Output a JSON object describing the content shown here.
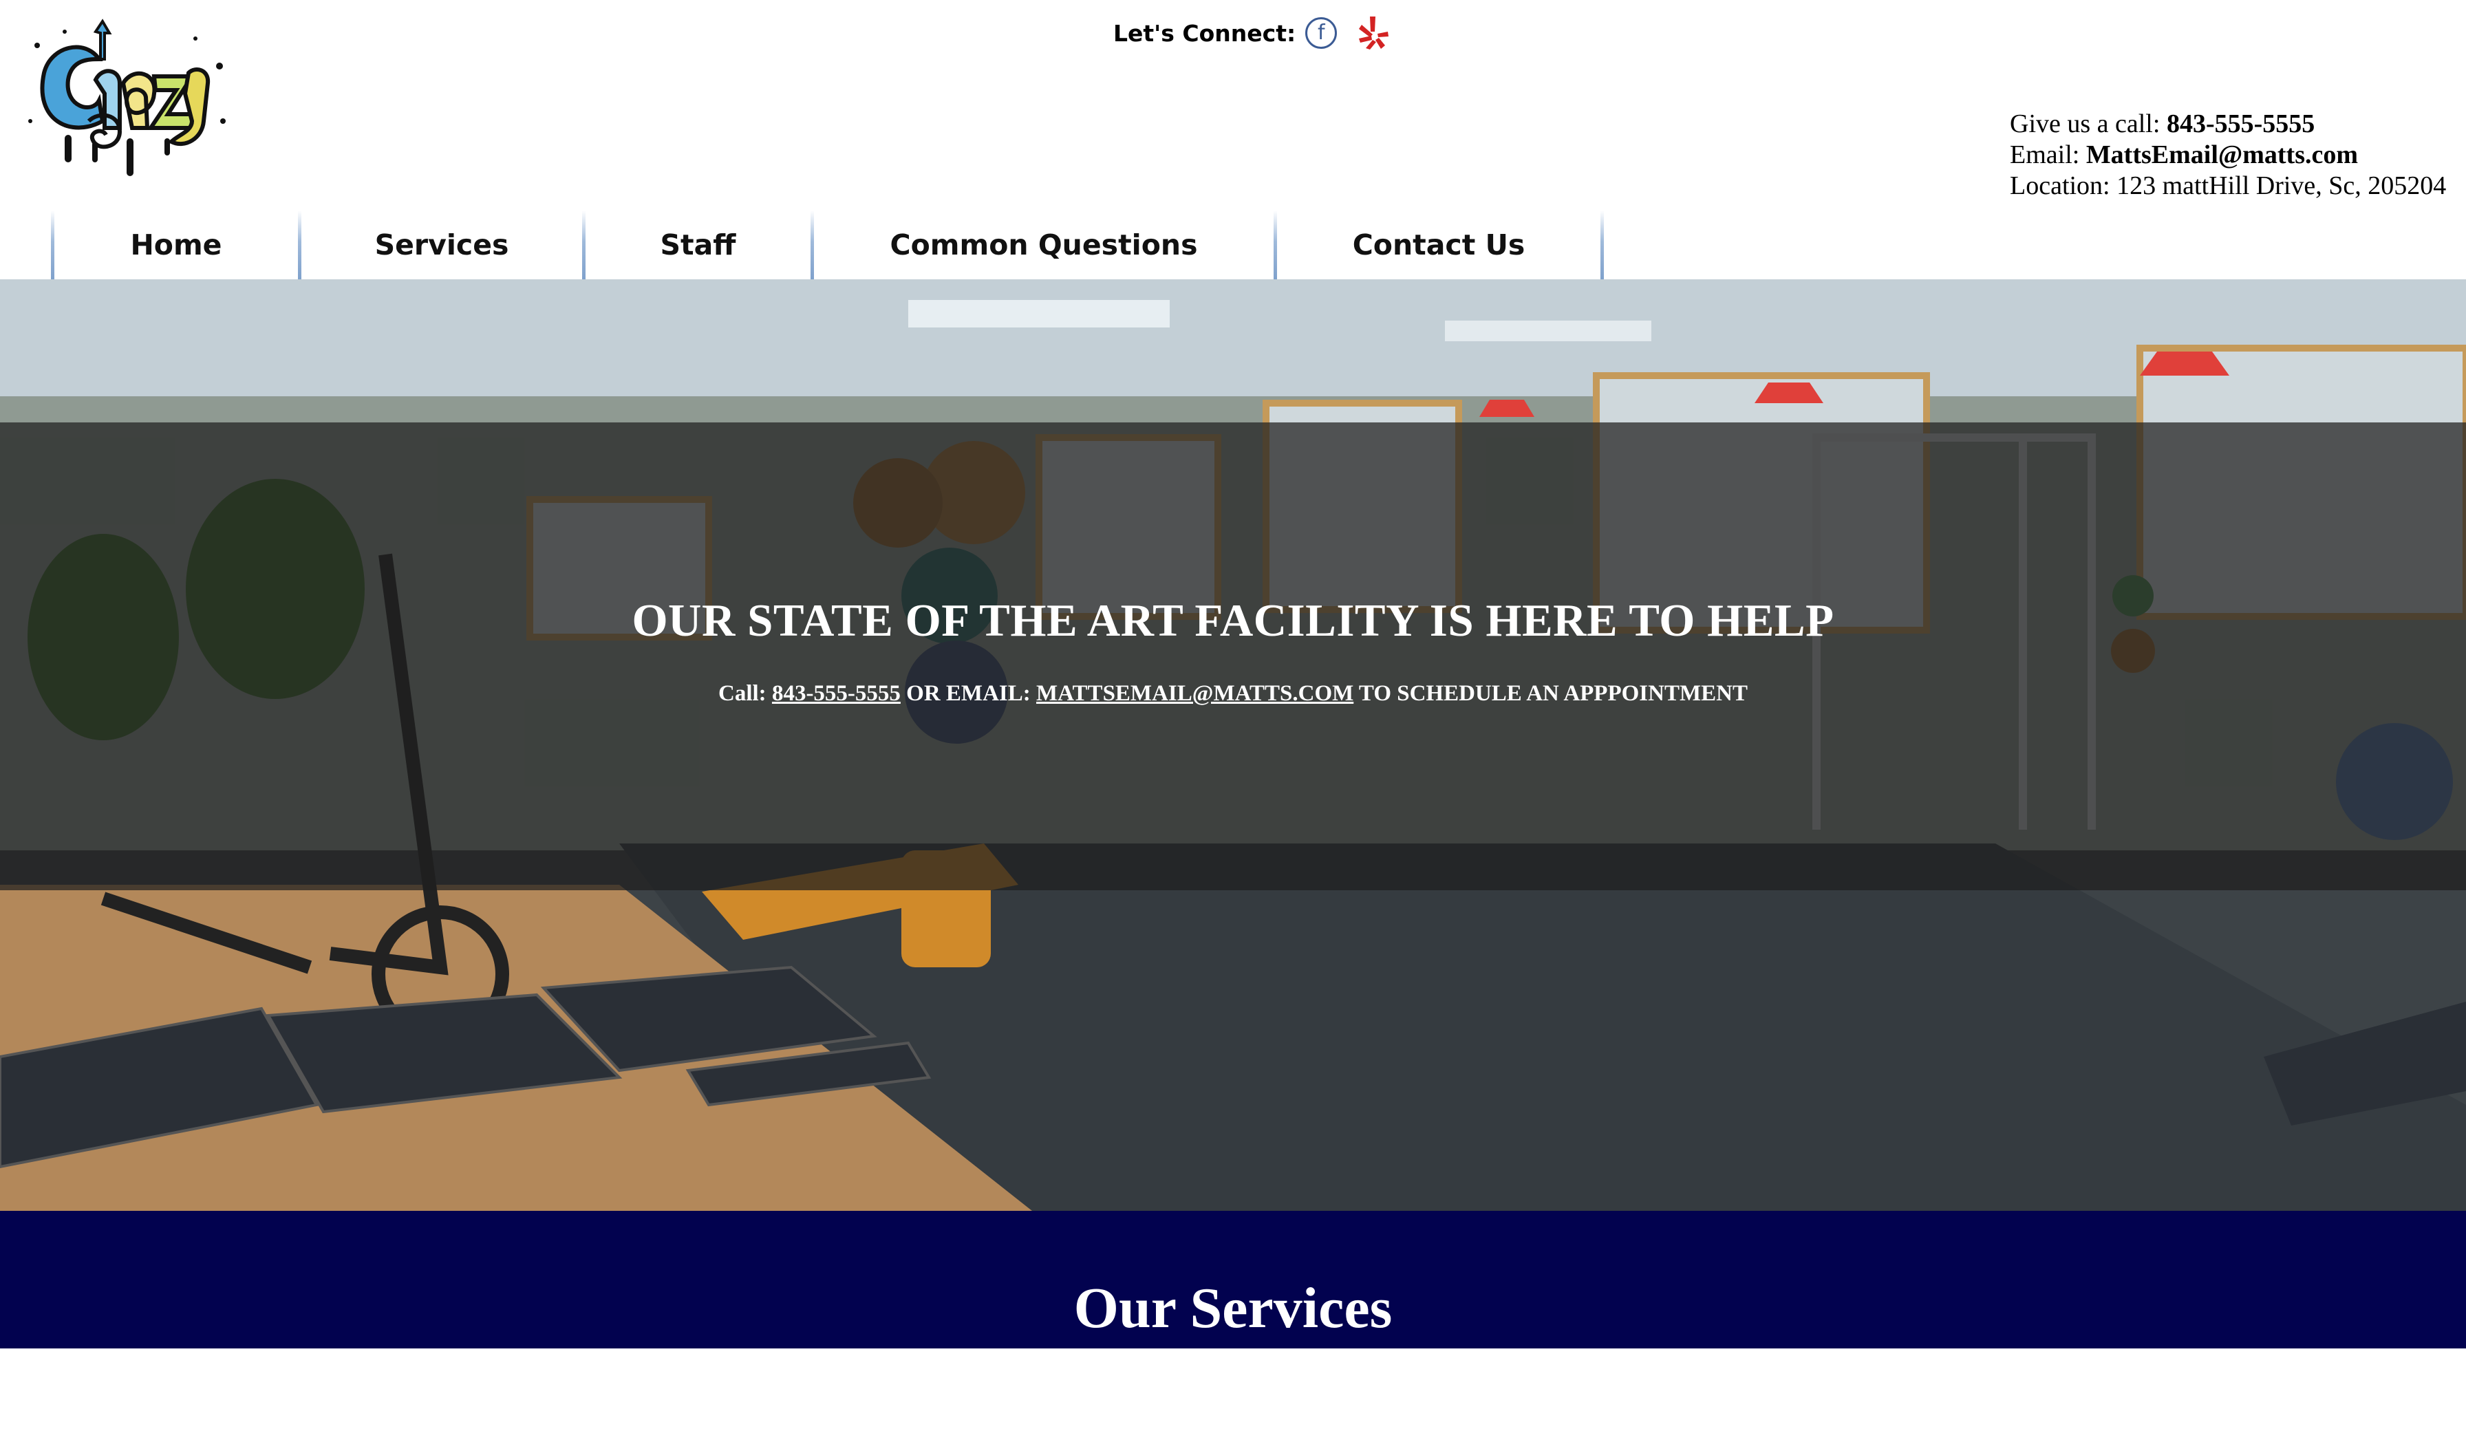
{
  "header": {
    "logo_text": "Crazy",
    "connect_label": "Let's Connect:",
    "social": [
      {
        "name": "facebook-icon",
        "glyph": "f",
        "color": "#3b5b94"
      },
      {
        "name": "yelp-icon",
        "color": "#d32323"
      }
    ],
    "contact": {
      "call_prefix": "Give us a call: ",
      "phone": "843-555-5555",
      "email_prefix": "Email: ",
      "email": "MattsEmail@matts.com",
      "location": "Location: 123 mattHill Drive, Sc, 205204"
    }
  },
  "nav": {
    "items": [
      {
        "label": "Home"
      },
      {
        "label": "Services"
      },
      {
        "label": "Staff"
      },
      {
        "label": "Common Questions"
      },
      {
        "label": "Contact Us"
      }
    ]
  },
  "hero": {
    "title": "OUR STATE OF THE ART FACILITY IS HERE TO HELP",
    "sub_call": "Call: ",
    "sub_phone": "843-555-5555",
    "sub_or": " OR EMAIL: ",
    "sub_email": "MATTSEMAIL@MATTS.COM",
    "sub_tail": " TO SCHEDULE AN APPPOINTMENT"
  },
  "services": {
    "title": "Our Services"
  },
  "colors": {
    "nav_separator": "#9fbadb",
    "services_bg": "#02024f",
    "facebook": "#3b5b94",
    "yelp": "#d32323"
  }
}
